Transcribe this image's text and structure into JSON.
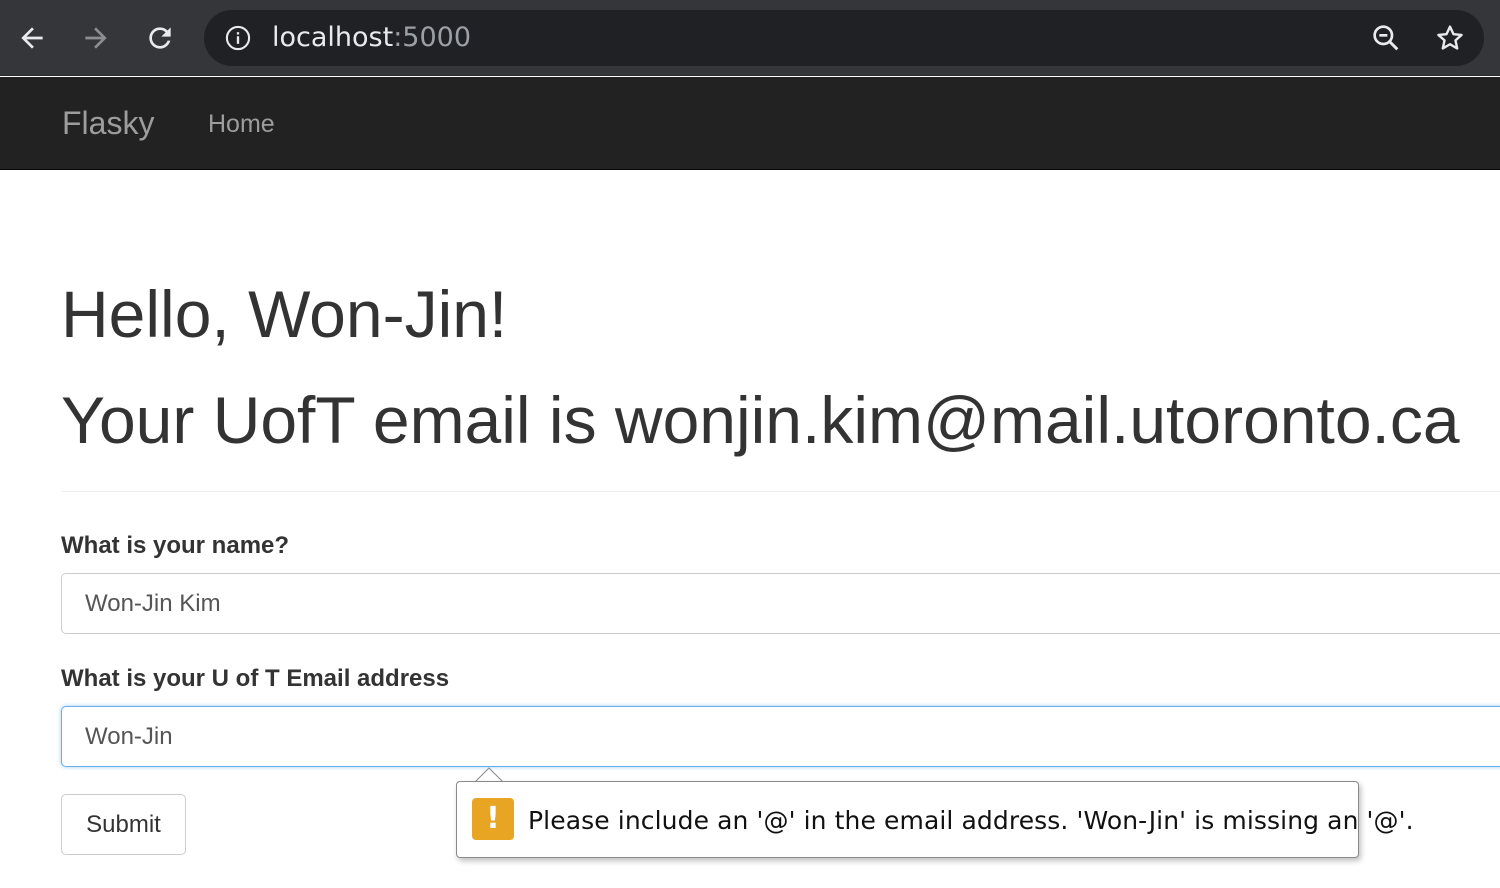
{
  "browser": {
    "url_host": "localhost",
    "url_port": ":5000",
    "icons": [
      "back-arrow-icon",
      "forward-arrow-icon",
      "reload-icon",
      "info-icon",
      "zoom-out-icon",
      "star-icon"
    ]
  },
  "navbar": {
    "brand": "Flasky",
    "links": [
      {
        "label": "Home"
      }
    ]
  },
  "main": {
    "greeting": "Hello, Won-Jin!",
    "email_line": "Your UofT email is wonjin.kim@mail.utoronto.ca"
  },
  "form": {
    "name_label": "What is your name?",
    "name_value": "Won-Jin Kim",
    "email_label": "What is your U of T Email address",
    "email_value": "Won-Jin",
    "submit_label": "Submit"
  },
  "validation": {
    "icon_glyph": "!",
    "message": "Please include an '@' in the email address. 'Won-Jin' is missing an '@'.",
    "icon_color": "#e8a423"
  }
}
